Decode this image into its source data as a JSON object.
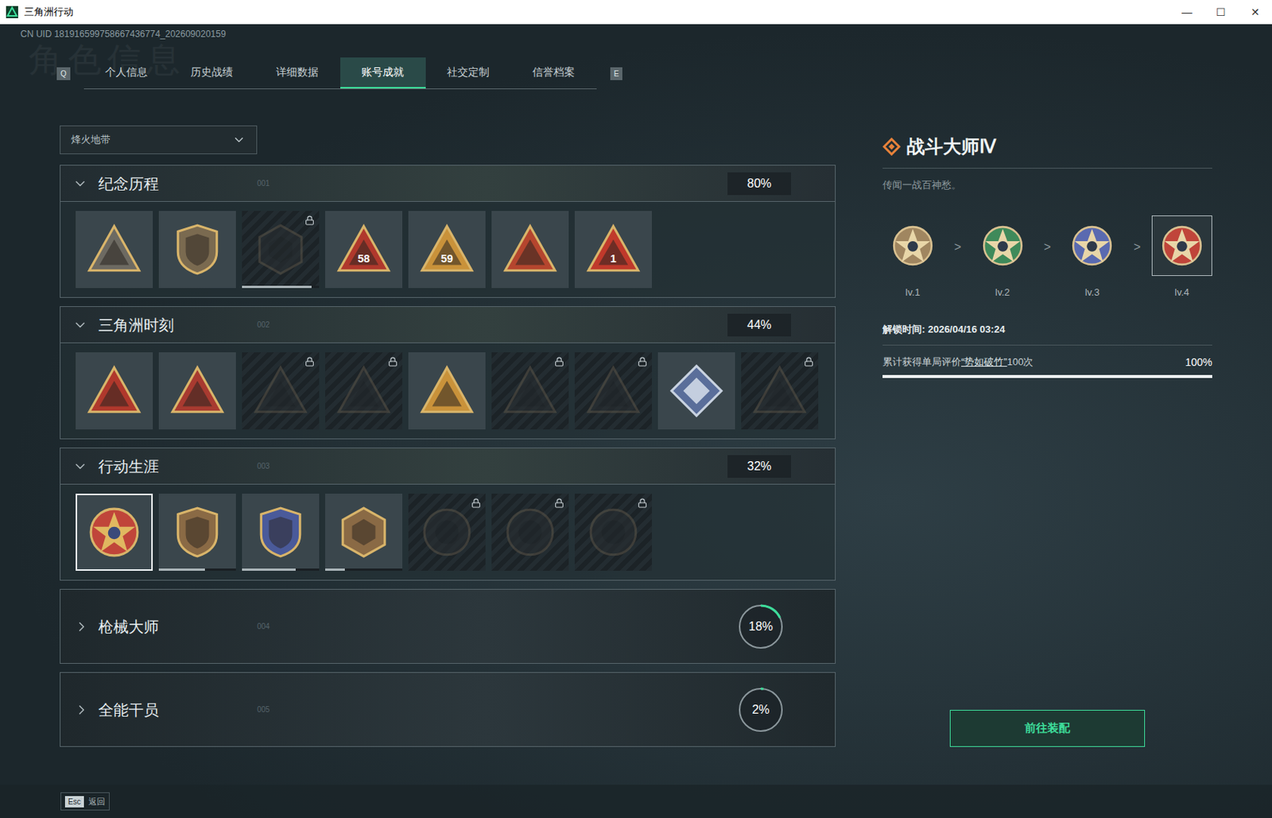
{
  "window": {
    "title": "三角洲行动",
    "controls": [
      "—",
      "☐",
      "✕"
    ]
  },
  "uid": "CN UID 181916599758667436774_202609020159",
  "watermark": "角色信息",
  "tabs": {
    "prev_key": "Q",
    "next_key": "E",
    "items": [
      {
        "label": "个人信息",
        "selected": false
      },
      {
        "label": "历史战绩",
        "selected": false
      },
      {
        "label": "详细数据",
        "selected": false
      },
      {
        "label": "账号成就",
        "selected": true
      },
      {
        "label": "社交定制",
        "selected": false
      },
      {
        "label": "信誉档案",
        "selected": false
      }
    ]
  },
  "mode_select": {
    "value": "烽火地带"
  },
  "sections": [
    {
      "title": "纪念历程",
      "code": "001",
      "percent": "80%",
      "level": 0.8,
      "expanded": true,
      "badges": [
        {
          "kind": "triangle",
          "label": "",
          "color": "#6d6a62",
          "locked": false,
          "selected": false,
          "level": null
        },
        {
          "kind": "shield",
          "label": "",
          "color": "#7a6a50",
          "locked": false,
          "selected": false,
          "level": null
        },
        {
          "kind": "hex",
          "label": "",
          "color": "#4a5258",
          "locked": true,
          "selected": false,
          "level": 0.9
        },
        {
          "kind": "triangle",
          "label": "58",
          "color": "#b0382c",
          "locked": false,
          "selected": false,
          "level": null
        },
        {
          "kind": "triangle",
          "label": "59",
          "color": "#c9923a",
          "locked": false,
          "selected": false,
          "level": null
        },
        {
          "kind": "triangle",
          "label": "",
          "color": "#b5452e",
          "locked": false,
          "selected": false,
          "level": null
        },
        {
          "kind": "triangle",
          "label": "1",
          "color": "#c0392b",
          "locked": false,
          "selected": false,
          "level": null
        }
      ]
    },
    {
      "title": "三角洲时刻",
      "code": "002",
      "percent": "44%",
      "level": 0.44,
      "expanded": true,
      "badges": [
        {
          "kind": "triangle",
          "label": "",
          "color": "#b0382c",
          "locked": false,
          "selected": false,
          "level": null
        },
        {
          "kind": "triangle",
          "label": "",
          "color": "#a83a30",
          "locked": false,
          "selected": false,
          "level": null
        },
        {
          "kind": "triangle",
          "label": "",
          "color": "#8a6a3a",
          "locked": true,
          "selected": false,
          "level": null
        },
        {
          "kind": "triangle",
          "label": "",
          "color": "#8a6a3a",
          "locked": true,
          "selected": false,
          "level": null
        },
        {
          "kind": "triangle",
          "label": "",
          "color": "#c9923a",
          "locked": false,
          "selected": false,
          "level": null
        },
        {
          "kind": "triangle",
          "label": "",
          "color": "#8a6a3a",
          "locked": true,
          "selected": false,
          "level": null
        },
        {
          "kind": "triangle",
          "label": "",
          "color": "#8a6a3a",
          "locked": true,
          "selected": false,
          "level": null
        },
        {
          "kind": "diamond",
          "label": "",
          "color": "#5a6e9a",
          "locked": false,
          "selected": false,
          "level": null
        },
        {
          "kind": "triangle",
          "label": "",
          "color": "#8a6a3a",
          "locked": true,
          "selected": false,
          "level": null
        }
      ]
    },
    {
      "title": "行动生涯",
      "code": "003",
      "percent": "32%",
      "level": 0.32,
      "expanded": true,
      "badges": [
        {
          "kind": "star",
          "label": "",
          "color": "#c0453a",
          "locked": false,
          "selected": true,
          "level": null
        },
        {
          "kind": "shield",
          "label": "",
          "color": "#8a6a45",
          "locked": false,
          "selected": false,
          "level": 0.6
        },
        {
          "kind": "shield",
          "label": "",
          "color": "#4a5a9a",
          "locked": false,
          "selected": false,
          "level": 0.7
        },
        {
          "kind": "hex",
          "label": "",
          "color": "#8a6a45",
          "locked": false,
          "selected": false,
          "level": 0.25
        },
        {
          "kind": "circle",
          "label": "",
          "color": "#6a5a40",
          "locked": true,
          "selected": false,
          "level": null
        },
        {
          "kind": "circle",
          "label": "",
          "color": "#6a5a40",
          "locked": true,
          "selected": false,
          "level": null
        },
        {
          "kind": "circle",
          "label": "",
          "color": "#6a5a40",
          "locked": true,
          "selected": false,
          "level": null
        }
      ]
    },
    {
      "title": "枪械大师",
      "code": "004",
      "percent": "18%",
      "level": 0.18,
      "expanded": false,
      "badges": []
    },
    {
      "title": "全能干员",
      "code": "005",
      "percent": "2%",
      "level": 0.02,
      "expanded": false,
      "badges": []
    }
  ],
  "detail": {
    "title": "战斗大师Ⅳ",
    "description": "传闻一战百神愁。",
    "separator": ">",
    "levels": [
      {
        "label": "lv.1",
        "color": "#a08660",
        "selected": false
      },
      {
        "label": "lv.2",
        "color": "#3f8a5a",
        "selected": false
      },
      {
        "label": "lv.3",
        "color": "#5a6ab0",
        "selected": false
      },
      {
        "label": "lv.4",
        "color": "#c0453a",
        "selected": true
      }
    ],
    "unlock": "解锁时间: 2026/04/16 03:24",
    "condition": {
      "prefix": "累计获得单局评价",
      "highlight": "“势如破竹”",
      "suffix": "100次",
      "percent": "100%",
      "level": 1
    },
    "button": "前往装配"
  },
  "footer": {
    "key": "Esc",
    "label": "返回"
  }
}
